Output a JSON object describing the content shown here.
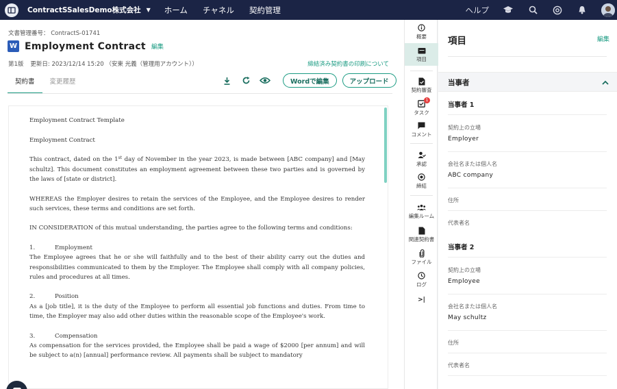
{
  "topbar": {
    "company": "ContractSSalesDemo株式会社",
    "nav": [
      "ホーム",
      "チャネル",
      "契約管理"
    ],
    "help": "ヘルプ"
  },
  "document": {
    "doc_number": "文書管理番号： ContractS-01741",
    "title": "Employment Contract",
    "edit": "編集",
    "version": "第1版",
    "updated": "更新日: 2023/12/14 15:20 （安東 光義（管理用アカウント））",
    "print_link": "締結済み契約書の印刷について",
    "tabs": [
      "契約書",
      "変更履歴"
    ],
    "word_edit": "Wordで編集",
    "upload": "アップロード"
  },
  "content": {
    "heading1": "Employment Contract Template",
    "heading2": "Employment Contract",
    "para1_a": "This contract, dated on the 1",
    "para1_sup": "st",
    "para1_b": " day of November in the year 2023, is made between [ABC company] and [May schultz]. This document constitutes an employment agreement between these two parties and is governed by the laws of [state or district].",
    "para2": "WHEREAS the Employer desires to retain the services of the Employee, and the Employee desires to render such services, these terms and conditions are set forth.",
    "para3": "IN CONSIDERATION of this mutual understanding, the parties agree to the following terms and conditions:",
    "sections": [
      {
        "num": "1.",
        "title": "Employment",
        "body": "The Employee agrees that he or she will faithfully and to the best of their ability carry out the duties and responsibilities communicated to them by the Employer. The Employee shall comply with all company policies, rules and procedures at all times."
      },
      {
        "num": "2.",
        "title": "Position",
        "body": "As a [job title], it is the duty of the Employee to perform all essential job functions and duties. From time to time, the Employer may also add other duties within the reasonable scope of the Employee's work."
      },
      {
        "num": "3.",
        "title": "Compensation",
        "body": "As compensation for the services provided, the Employee shall be paid a wage of $2000 [per annum] and will be subject to a(n) [annual] performance review. All payments shall be subject to mandatory"
      }
    ]
  },
  "rail": {
    "items": [
      "概要",
      "項目",
      "契約審査",
      "タスク",
      "コメント",
      "承認",
      "締結",
      "編集ルーム",
      "関連契約書",
      "ファイル",
      "ログ"
    ],
    "task_badge": "1",
    "collapse": ">|"
  },
  "panel": {
    "title": "項目",
    "edit": "編集",
    "section": "当事者",
    "party1": {
      "heading": "当事者 1",
      "role_label": "契約上の立場",
      "role_value": "Employer",
      "name_label": "会社名または個人名",
      "name_value": "ABC company",
      "address_label": "住所",
      "rep_label": "代表者名"
    },
    "party2": {
      "heading": "当事者 2",
      "role_label": "契約上の立場",
      "role_value": "Employee",
      "name_label": "会社名または個人名",
      "name_value": "May schultz",
      "address_label": "住所",
      "rep_label": "代表者名"
    }
  },
  "colors": {
    "topbar": "#1b2445",
    "accent": "#1a9b82",
    "word_blue": "#2b5cb8",
    "badge": "#e53e3e"
  }
}
